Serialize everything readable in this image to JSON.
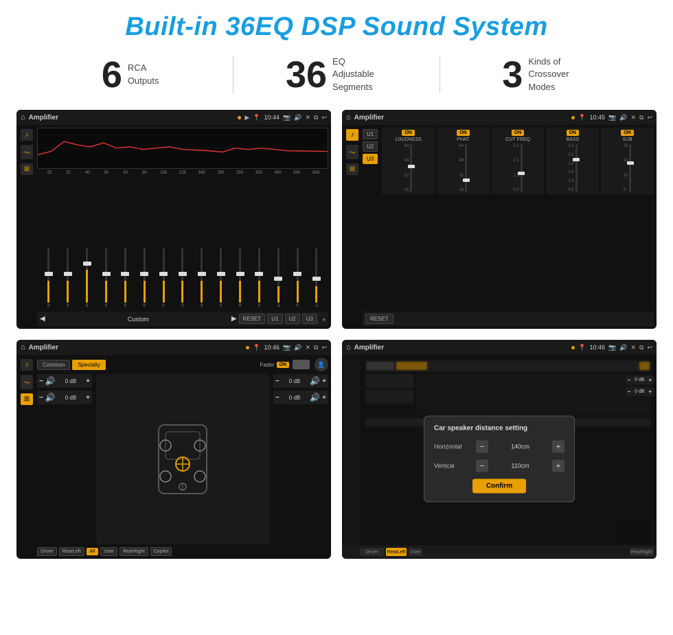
{
  "page": {
    "title": "Built-in 36EQ DSP Sound System",
    "specs": [
      {
        "number": "6",
        "text_line1": "RCA",
        "text_line2": "Outputs"
      },
      {
        "number": "36",
        "text_line1": "EQ Adjustable",
        "text_line2": "Segments"
      },
      {
        "number": "3",
        "text_line1": "Kinds of",
        "text_line2": "Crossover Modes"
      }
    ]
  },
  "screen1": {
    "title": "Amplifier",
    "time": "10:44",
    "eq_labels": [
      "25",
      "32",
      "40",
      "50",
      "63",
      "80",
      "100",
      "125",
      "160",
      "200",
      "250",
      "320",
      "400",
      "500",
      "630"
    ],
    "eq_values": [
      "0",
      "0",
      "5",
      "0",
      "0",
      "0",
      "0",
      "0",
      "0",
      "0",
      "0",
      "0",
      "-1",
      "0",
      "-1"
    ],
    "preset": "Custom",
    "buttons": [
      "RESET",
      "U1",
      "U2",
      "U3"
    ]
  },
  "screen2": {
    "title": "Amplifier",
    "time": "10:45",
    "u_buttons": [
      "U1",
      "U2",
      "U3"
    ],
    "active_u": "U3",
    "channels": [
      {
        "on": true,
        "label": "LOUDNESS"
      },
      {
        "on": true,
        "label": "PHAT"
      },
      {
        "on": true,
        "label": "CUT FREQ"
      },
      {
        "on": true,
        "label": "BASS"
      },
      {
        "on": true,
        "label": "SUB"
      }
    ],
    "reset_label": "RESET"
  },
  "screen3": {
    "title": "Amplifier",
    "time": "10:46",
    "tabs": [
      "Common",
      "Specialty"
    ],
    "active_tab": "Specialty",
    "fader_label": "Fader",
    "fader_on": "ON",
    "vol_rows": [
      {
        "val": "0 dB"
      },
      {
        "val": "0 dB"
      },
      {
        "val": "0 dB"
      },
      {
        "val": "0 dB"
      }
    ],
    "bottom_btns": [
      "Driver",
      "RearLeft",
      "All",
      "User",
      "RearRight",
      "Copilot"
    ]
  },
  "screen4": {
    "title": "Amplifier",
    "time": "10:46",
    "tabs": [
      "Common",
      "Specialty"
    ],
    "dialog": {
      "title": "Car speaker distance setting",
      "rows": [
        {
          "label": "Horizontal",
          "value": "140cm"
        },
        {
          "label": "Vertical",
          "value": "110cm"
        }
      ],
      "confirm_label": "Confirm"
    }
  },
  "icons": {
    "home": "⌂",
    "nav_dot": "●",
    "play": "▶",
    "back_arrow": "↩",
    "pin": "📍",
    "speaker": "🔊",
    "x": "✕",
    "clone": "⧉",
    "eq_tune": "♪",
    "sliders": "≡",
    "waveform": "〜",
    "crosshair": "+",
    "arrows": "⊕"
  }
}
